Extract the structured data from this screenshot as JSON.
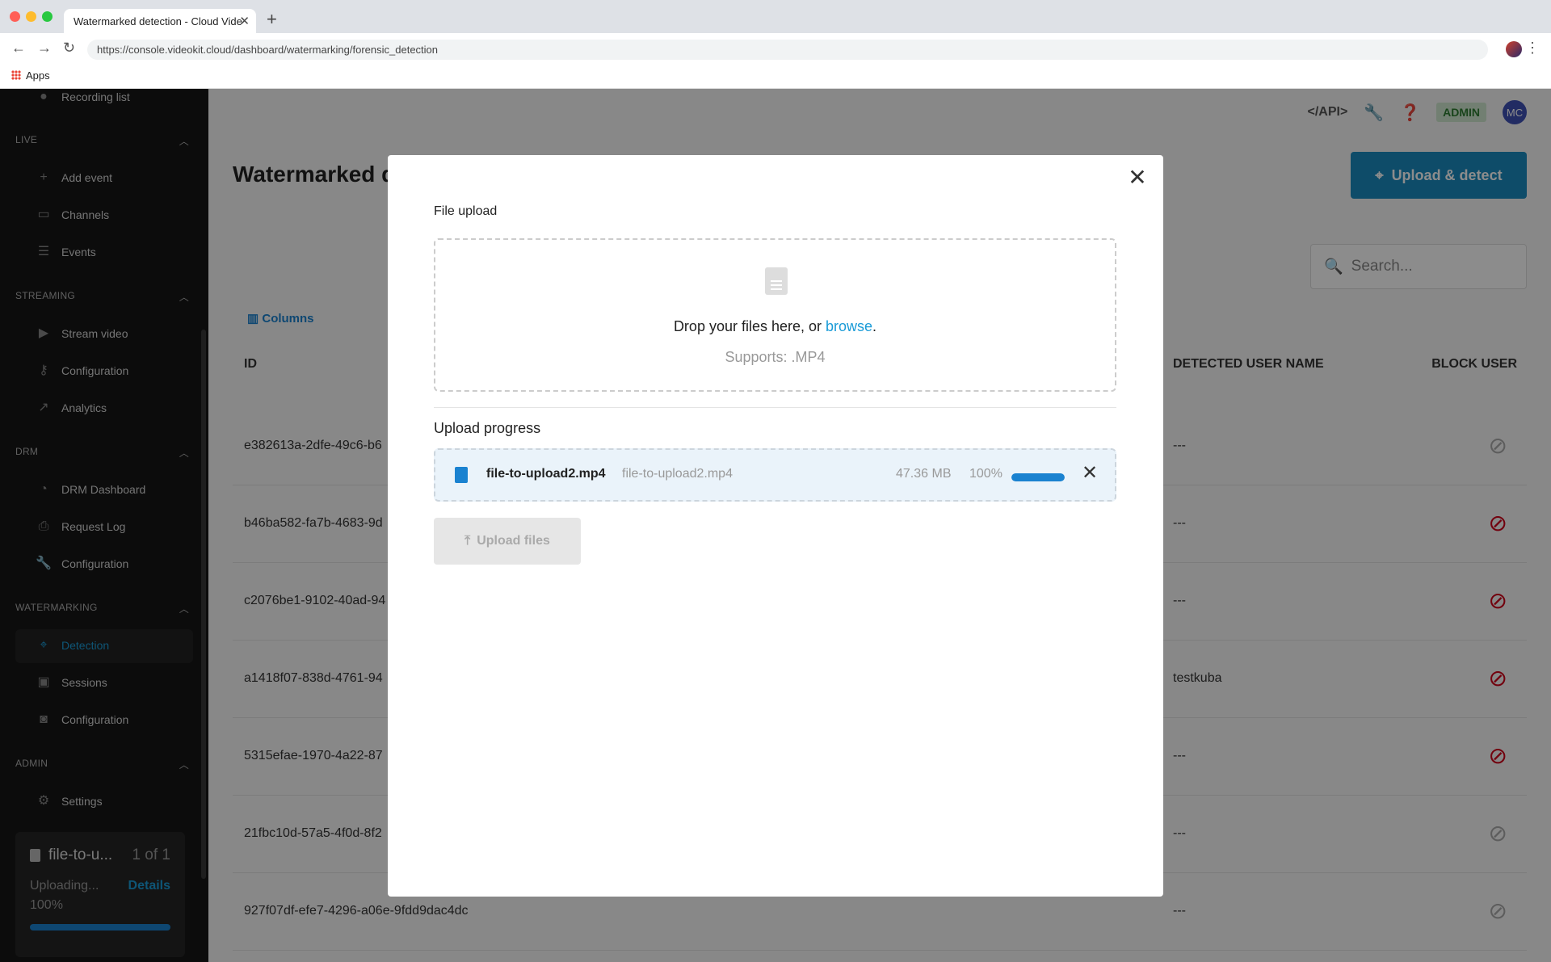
{
  "browser": {
    "tab_title": "Watermarked detection - Cloud Vide",
    "url": "https://console.videokit.cloud/dashboard/watermarking/forensic_detection",
    "bookmark_apps": "Apps"
  },
  "sidebar": {
    "recording_list": "Recording list",
    "live": {
      "title": "LIVE",
      "items": [
        "Add event",
        "Channels",
        "Events"
      ]
    },
    "streaming": {
      "title": "STREAMING",
      "items": [
        "Stream video",
        "Configuration",
        "Analytics"
      ]
    },
    "drm": {
      "title": "DRM",
      "items": [
        "DRM Dashboard",
        "Request Log",
        "Configuration"
      ]
    },
    "watermarking": {
      "title": "WATERMARKING",
      "items": [
        "Detection",
        "Sessions",
        "Configuration"
      ],
      "active": "Detection"
    },
    "admin": {
      "title": "ADMIN",
      "items": [
        "Settings"
      ]
    },
    "upload_status": {
      "file": "file-to-u...",
      "count": "1 of 1",
      "status": "Uploading...",
      "details": "Details",
      "percent": "100%",
      "progress": 1.0
    }
  },
  "header": {
    "api_label": "</API>",
    "role_badge": "ADMIN",
    "avatar_initials": "MC"
  },
  "page": {
    "title": "Watermarked d",
    "upload_detect_button": "Upload & detect",
    "search_placeholder": "Search...",
    "columns_button": "Columns",
    "table": {
      "headers": {
        "id": "ID",
        "detected_user": "DETECTED USER NAME",
        "block_user": "BLOCK USER"
      },
      "rows": [
        {
          "id": "e382613a-2dfe-49c6-b6",
          "user": "---",
          "blocked": false
        },
        {
          "id": "b46ba582-fa7b-4683-9d",
          "user": "---",
          "blocked": true
        },
        {
          "id": "c2076be1-9102-40ad-94",
          "user": "---",
          "blocked": true
        },
        {
          "id": "a1418f07-838d-4761-94",
          "user": "testkuba",
          "blocked": true
        },
        {
          "id": "5315efae-1970-4a22-87",
          "user": "---",
          "blocked": true
        },
        {
          "id": "21fbc10d-57a5-4f0d-8f2",
          "user": "---",
          "blocked": false
        },
        {
          "id": "927f07df-efe7-4296-a06e-9fdd9dac4dc",
          "user": "---",
          "blocked": false
        }
      ]
    }
  },
  "modal": {
    "file_upload_label": "File upload",
    "drop_text": "Drop your files here, or ",
    "browse_link": "browse",
    "drop_period": ".",
    "supports": "Supports: .MP4",
    "progress_label": "Upload progress",
    "file": {
      "name": "file-to-upload2.mp4",
      "secondary_name": "file-to-upload2.mp4",
      "size": "47.36 MB",
      "percent": "100%",
      "progress": 1.0
    },
    "upload_button": "Upload files"
  },
  "colors": {
    "accent": "#1a82d0",
    "primary_button": "#1a8bbf",
    "block_red": "#d0021b",
    "sidebar_bg": "#161616"
  }
}
